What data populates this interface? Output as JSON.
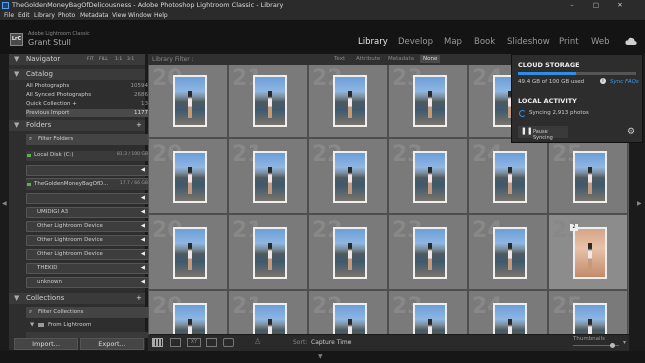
{
  "window": {
    "title": "TheGoldenMoneyBagOfDelicousness - Adobe Photoshop Lightroom Classic - Library",
    "minimize": "–",
    "maximize": "□",
    "close": "✕"
  },
  "menu": [
    "File",
    "Edit",
    "Library",
    "Photo",
    "Metadata",
    "View",
    "Window",
    "Help"
  ],
  "identity": {
    "logo": "LrC",
    "app": "Adobe Lightroom Classic",
    "user": "Grant Stull"
  },
  "modules": [
    "Library",
    "Develop",
    "Map",
    "Book",
    "Slideshow",
    "Print",
    "Web"
  ],
  "active_module": "Library",
  "navigator": {
    "label": "Navigator",
    "zoom": [
      "FIT",
      "FILL",
      "1:1",
      "3:1"
    ]
  },
  "catalog": {
    "label": "Catalog",
    "items": [
      {
        "label": "All Photographs",
        "count": "10594"
      },
      {
        "label": "All Synced Photographs",
        "count": "2686"
      },
      {
        "label": "Quick Collection +",
        "count": "13"
      },
      {
        "label": "Previous Import",
        "count": "1177"
      }
    ]
  },
  "folders": {
    "label": "Folders",
    "filter": "Filter Folders",
    "disk": {
      "label": "Local Disk (C:)",
      "usage": "81.3 / 100 GB"
    },
    "volume": {
      "label": "TheGoldenMoneyBagOfD...",
      "usage": "17.7 / 66 GB"
    },
    "devices": [
      "UMIDIGI A3",
      "Other Lightroom Device",
      "Other Lightroom Device",
      "Other Lightroom Device",
      "THEKID",
      "unknown"
    ]
  },
  "collections": {
    "label": "Collections",
    "filter": "Filter Collections",
    "set": "From Lightroom"
  },
  "buttons": {
    "import": "Import...",
    "export": "Export..."
  },
  "filterbar": {
    "label": "Library Filter :",
    "options": [
      "Text",
      "Attribute",
      "Metadata",
      "None"
    ],
    "selected": "None"
  },
  "grid": {
    "row_numbers": [
      "20",
      "21",
      "22",
      "23",
      "24",
      "25"
    ],
    "badge": "2"
  },
  "toolbar": {
    "sort_label": "Sort:",
    "sort_value": "Capture Time",
    "thumbnails": "Thumbnails"
  },
  "cloud": {
    "storage_title": "CLOUD STORAGE",
    "storage_used": "49.4 GB of 100 GB used",
    "storage_fraction": 0.494,
    "sync_faqs": "Sync FAQs",
    "activity_title": "LOCAL ACTIVITY",
    "syncing": "Syncing 2,913 photos",
    "pause": "Pause Syncing"
  },
  "colors": {
    "accent": "#2d8ee8",
    "panel": "#2e2e2e",
    "grid": "#5a5a5a"
  }
}
